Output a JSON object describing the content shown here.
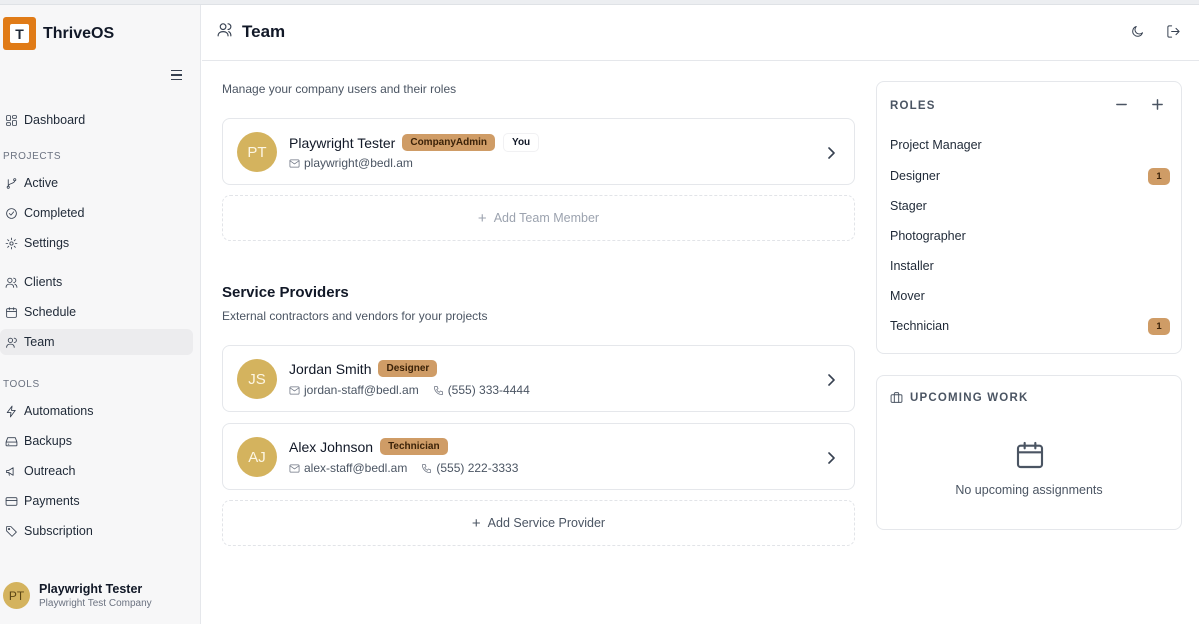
{
  "app": {
    "name": "ThriveOS",
    "logo_letter": "T"
  },
  "sidebar": {
    "items_top": [
      {
        "label": "Dashboard",
        "icon": "dashboard-icon"
      }
    ],
    "projects_label": "PROJECTS",
    "projects": [
      {
        "label": "Active",
        "icon": "branch-icon"
      },
      {
        "label": "Completed",
        "icon": "check-circle-icon"
      },
      {
        "label": "Settings",
        "icon": "gear-icon"
      }
    ],
    "main": [
      {
        "label": "Clients",
        "icon": "users-icon"
      },
      {
        "label": "Schedule",
        "icon": "calendar-icon"
      },
      {
        "label": "Team",
        "icon": "user-icon",
        "active": true
      }
    ],
    "tools_label": "TOOLS",
    "tools": [
      {
        "label": "Automations",
        "icon": "zap-icon"
      },
      {
        "label": "Backups",
        "icon": "hard-drive-icon"
      },
      {
        "label": "Outreach",
        "icon": "megaphone-icon"
      },
      {
        "label": "Payments",
        "icon": "credit-card-icon"
      },
      {
        "label": "Subscription",
        "icon": "tag-icon"
      }
    ],
    "user": {
      "initials": "PT",
      "name": "Playwright Tester",
      "company": "Playwright Test Company"
    }
  },
  "header": {
    "title": "Team"
  },
  "team": {
    "subtitle": "Manage your company users and their roles",
    "members": [
      {
        "initials": "PT",
        "name": "Playwright Tester",
        "badge": "CompanyAdmin",
        "you": "You",
        "email": "playwright@bedl.am"
      }
    ],
    "add_label": "Add Team Member"
  },
  "providers": {
    "title": "Service Providers",
    "subtitle": "External contractors and vendors for your projects",
    "items": [
      {
        "initials": "JS",
        "name": "Jordan Smith",
        "badge": "Designer",
        "email": "jordan-staff@bedl.am",
        "phone": "(555) 333-4444"
      },
      {
        "initials": "AJ",
        "name": "Alex Johnson",
        "badge": "Technician",
        "email": "alex-staff@bedl.am",
        "phone": "(555) 222-3333"
      }
    ],
    "add_label": "Add Service Provider"
  },
  "roles": {
    "title": "ROLES",
    "items": [
      {
        "label": "Project Manager",
        "count": ""
      },
      {
        "label": "Designer",
        "count": "1"
      },
      {
        "label": "Stager",
        "count": ""
      },
      {
        "label": "Photographer",
        "count": ""
      },
      {
        "label": "Installer",
        "count": ""
      },
      {
        "label": "Mover",
        "count": ""
      },
      {
        "label": "Technician",
        "count": "1"
      }
    ]
  },
  "upcoming": {
    "title": "UPCOMING WORK",
    "empty": "No upcoming assignments"
  },
  "colors": {
    "accent": "#e07b17",
    "badge": "#cf9c66",
    "avatar": "#d4b35e"
  }
}
